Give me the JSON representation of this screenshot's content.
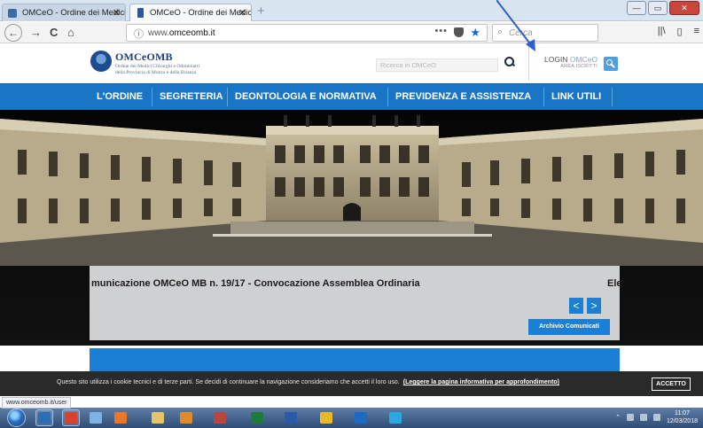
{
  "browser": {
    "tabs": [
      {
        "title": "OMCeO - Ordine dei Medici Ch",
        "close": "✕"
      },
      {
        "title": "OMCeO - Ordine dei Medici Ch",
        "close": "✕"
      }
    ],
    "new_tab": "+",
    "url_prefix": "www.",
    "url_domain": "omceomb.it",
    "url_dots": "•••",
    "search_placeholder": "Cerca",
    "window_controls": {
      "minimize": "—",
      "maximize": "▭",
      "close": "✕"
    },
    "nav_icons": {
      "back": "←",
      "forward": "→",
      "reload": "C",
      "home": "⌂",
      "library": "||\\",
      "sidebar": "▯",
      "menu": "≡"
    }
  },
  "site": {
    "logo_name": "OMCeOMB",
    "logo_subtitle_1": "Ordine dei Medici Chirurghi e Odontoiatri",
    "logo_subtitle_2": "della Provincia di Monza e della Brianza",
    "search_placeholder": "Ricerca in OMCeO",
    "login_label": "LOGIN",
    "login_brand": "OMCeO",
    "login_sub": "AREA ISCRITTI"
  },
  "menu": [
    {
      "label": "L'ORDINE"
    },
    {
      "label": "SEGRETERIA"
    },
    {
      "label": "DEONTOLOGIA E NORMATIVA"
    },
    {
      "label": "PREVIDENZA E ASSISTENZA"
    },
    {
      "label": "LINK UTILI"
    }
  ],
  "slider": {
    "current_title": "municazione OMCeO MB n. 19/17 - Convocazione Assemblea Ordinaria",
    "next_title": "Ele",
    "prev_arrow": "<",
    "next_arrow": ">",
    "archive_button": "Archivio Comunicati"
  },
  "cookie": {
    "text": "Questo sito utilizza i cookie tecnici e di terze parti. Se decidi di continuare la navigazione consideriamo che accetti il loro uso.",
    "link": "(Leggere la pagina informativa per approfondimento)",
    "accept": "ACCETTO"
  },
  "status_url": "www.omceomb.it/user",
  "taskbar": {
    "apps": [
      {
        "name": "explorer",
        "color": "#2c6db3"
      },
      {
        "name": "media-player",
        "color": "#d9412e"
      },
      {
        "name": "paint",
        "color": "#7fb2e5"
      },
      {
        "name": "firefox",
        "color": "#e8762b"
      },
      {
        "name": "folder",
        "color": "#e6c467"
      },
      {
        "name": "outlook-calendar",
        "color": "#e08a2e"
      },
      {
        "name": "tool",
        "color": "#b8473f"
      },
      {
        "name": "excel",
        "color": "#1f7a3e"
      },
      {
        "name": "word",
        "color": "#2b5aa8"
      },
      {
        "name": "chrome",
        "color": "#e9b928"
      },
      {
        "name": "outlook",
        "color": "#1b6bc4"
      },
      {
        "name": "skype-like",
        "color": "#2aa9e0"
      }
    ],
    "clock_time": "11:07",
    "clock_date": "12/03/2018"
  }
}
